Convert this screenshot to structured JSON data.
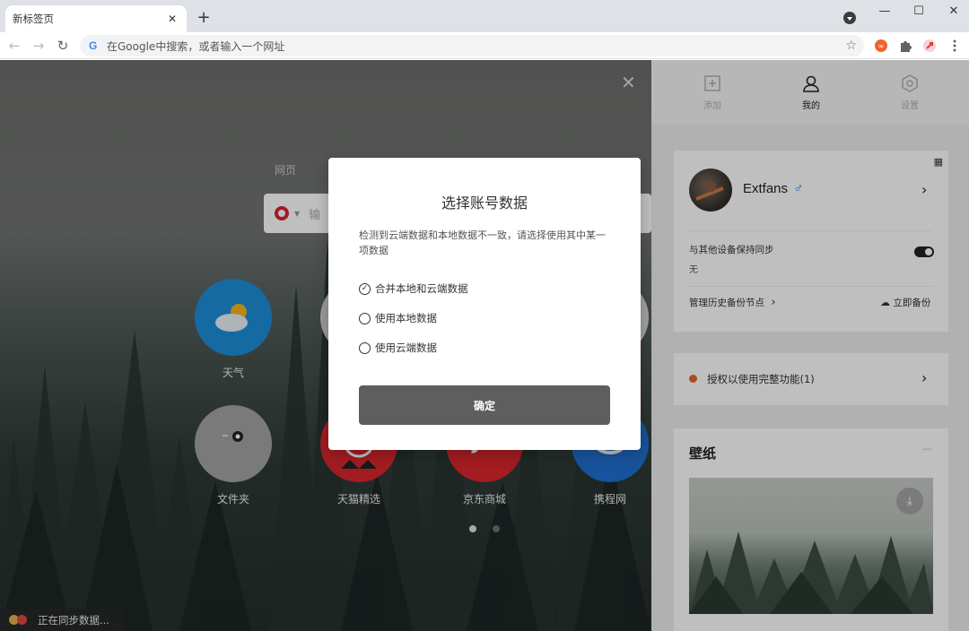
{
  "browser": {
    "tab_title": "新标签页",
    "omnibox_placeholder": "在Google中搜索，或者输入一个网址"
  },
  "newtab": {
    "search_tab_label": "网页",
    "search_placeholder": "输",
    "shortcuts": [
      {
        "label": "天气",
        "icon": "weather-icon",
        "color": "#1e8ed8"
      },
      {
        "label": "文件夹",
        "icon": "folder-icon",
        "color": "#a3a3a3"
      },
      {
        "label": "天猫精选",
        "icon": "tmall-icon",
        "color": "#d9262c"
      },
      {
        "label": "京东商城",
        "icon": "jd-icon",
        "color": "#d9262c"
      },
      {
        "label": "携程网",
        "icon": "ctrip-icon",
        "color": "#1f6fd1"
      }
    ],
    "pager_active": 1,
    "sync_status": "正在同步数据..."
  },
  "dialog": {
    "title": "选择账号数据",
    "description": "检测到云端数据和本地数据不一致，请选择使用其中某一项数据",
    "options": [
      {
        "label": "合并本地和云端数据",
        "checked": true
      },
      {
        "label": "使用本地数据",
        "checked": false
      },
      {
        "label": "使用云端数据",
        "checked": false
      }
    ],
    "confirm_label": "确定"
  },
  "panel": {
    "tabs": [
      {
        "label": "添加",
        "icon": "add-icon",
        "active": false
      },
      {
        "label": "我的",
        "icon": "user-icon",
        "active": true
      },
      {
        "label": "设置",
        "icon": "settings-icon",
        "active": false
      }
    ],
    "account": {
      "username": "Extfans",
      "gender_symbol": "♂",
      "sync_label": "与其他设备保持同步",
      "sync_value": "无",
      "sync_enabled": true,
      "history_backup_label": "管理历史备份节点",
      "backup_now_label": "立即备份"
    },
    "license": {
      "label": "授权以使用完整功能(1)",
      "dot_color": "#e0672c"
    },
    "wallpaper": {
      "title": "壁纸",
      "collapse_symbol": "—"
    }
  }
}
